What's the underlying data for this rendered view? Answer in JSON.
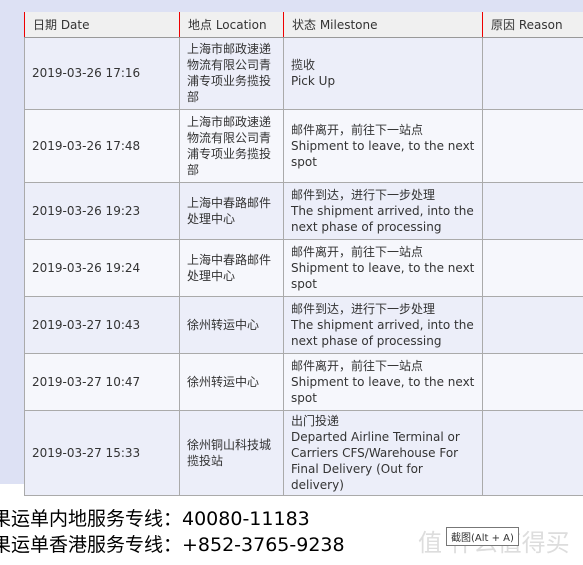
{
  "headers": [
    "日期 Date",
    "地点 Location",
    "状态 Milestone",
    "原因 Reason"
  ],
  "rows": [
    {
      "date": "2019-03-26 17:16",
      "location": "上海市邮政速递物流有限公司青浦专项业务揽投部",
      "status_cn": "揽收",
      "status_en": "Pick Up",
      "reason": ""
    },
    {
      "date": "2019-03-26 17:48",
      "location": "上海市邮政速递物流有限公司青浦专项业务揽投部",
      "status_cn": "邮件离开，前往下一站点",
      "status_en": "Shipment to leave, to the next spot",
      "reason": ""
    },
    {
      "date": "2019-03-26 19:23",
      "location": "上海中春路邮件处理中心",
      "status_cn": "邮件到达，进行下一步处理",
      "status_en": "The shipment arrived, into the next phase of processing",
      "reason": ""
    },
    {
      "date": "2019-03-26 19:24",
      "location": "上海中春路邮件处理中心",
      "status_cn": "邮件离开，前往下一站点",
      "status_en": "Shipment to leave, to the next spot",
      "reason": ""
    },
    {
      "date": "2019-03-27 10:43",
      "location": "徐州转运中心",
      "status_cn": "邮件到达，进行下一步处理",
      "status_en": "The shipment arrived, into the next phase of processing",
      "reason": ""
    },
    {
      "date": "2019-03-27 10:47",
      "location": "徐州转运中心",
      "status_cn": "邮件离开，前往下一站点",
      "status_en": "Shipment to leave, to the next spot",
      "reason": ""
    },
    {
      "date": "2019-03-27 15:33",
      "location": "徐州铜山科技城揽投站",
      "status_cn": "出门投递",
      "status_en": "Departed Airline Terminal or Carriers CFS/Warehouse For Final Delivery (Out for delivery)",
      "reason": ""
    }
  ],
  "footer": [
    "果运单内地服务专线：40080-11183",
    "果运单香港服务专线：+852-3765-9238"
  ],
  "watermark": "值 什么值得买",
  "tooltip": "截图(Alt + A)"
}
